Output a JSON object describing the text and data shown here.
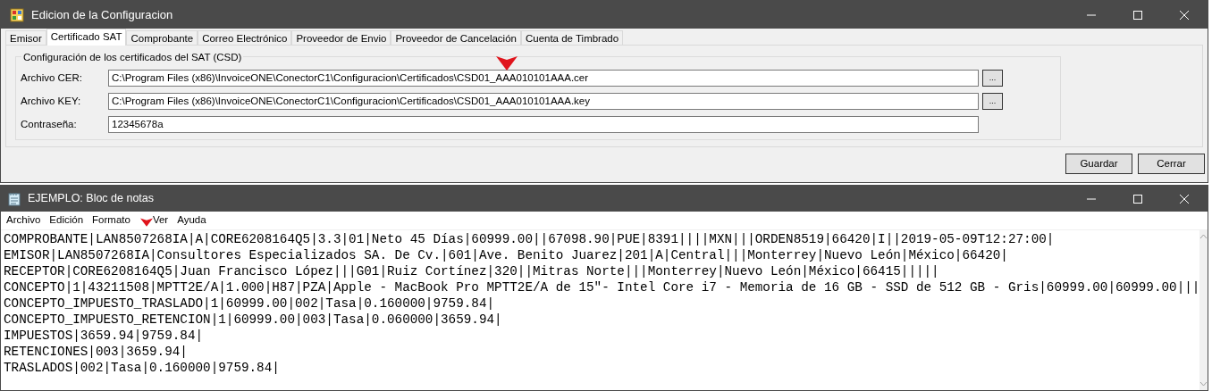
{
  "config_window": {
    "title": "Edicion de la Configuracion",
    "tabs": [
      {
        "label": "Emisor",
        "selected": false
      },
      {
        "label": "Certificado SAT",
        "selected": true
      },
      {
        "label": "Comprobante",
        "selected": false
      },
      {
        "label": "Correo Electrónico",
        "selected": false
      },
      {
        "label": "Proveedor de Envio",
        "selected": false
      },
      {
        "label": "Proveedor de Cancelación",
        "selected": false
      },
      {
        "label": "Cuenta de Timbrado",
        "selected": false
      }
    ],
    "group_title": "Configuración de los certificados del SAT (CSD)",
    "fields": [
      {
        "label": "Archivo CER:",
        "value": "C:\\Program Files (x86)\\InvoiceONE\\ConectorC1\\Configuracion\\Certificados\\CSD01_AAA010101AAA.cer",
        "browse": "..."
      },
      {
        "label": "Archivo KEY:",
        "value": "C:\\Program Files (x86)\\InvoiceONE\\ConectorC1\\Configuracion\\Certificados\\CSD01_AAA010101AAA.key",
        "browse": "..."
      },
      {
        "label": "Contraseña:",
        "value": "12345678a"
      }
    ],
    "buttons": [
      "Guardar",
      "Cerrar"
    ]
  },
  "notepad": {
    "title": "EJEMPLO: Bloc de notas",
    "menu": [
      "Archivo",
      "Edición",
      "Formato",
      "Ver",
      "Ayuda"
    ],
    "lines": [
      "COMPROBANTE|LAN8507268IA|A|CORE6208164Q5|3.3|01|Neto 45 Días|60999.00||67098.90|PUE|8391||||MXN|||ORDEN8519|66420|I||2019-05-09T12:27:00|",
      "EMISOR|LAN8507268IA|Consultores Especializados SA. De Cv.|601|Ave. Benito Juarez|201|A|Central|||Monterrey|Nuevo León|México|66420|",
      "RECEPTOR|CORE6208164Q5|Juan Francisco López|||G01|Ruiz Cortínez|320||Mitras Norte|||Monterrey|Nuevo León|México|66415|||||",
      "CONCEPTO|1|43211508|MPTT2E/A|1.000|H87|PZA|Apple - MacBook Pro MPTT2E/A de 15\"- Intel Core i7 - Memoria de 16 GB - SSD de 512 GB - Gris|60999.00|60999.00|||",
      "CONCEPTO_IMPUESTO_TRASLADO|1|60999.00|002|Tasa|0.160000|9759.84|",
      "CONCEPTO_IMPUESTO_RETENCION|1|60999.00|003|Tasa|0.060000|3659.94|",
      "IMPUESTOS|3659.94|9759.84|",
      "RETENCIONES|003|3659.94|",
      "TRASLADOS|002|Tasa|0.160000|9759.84|"
    ]
  }
}
